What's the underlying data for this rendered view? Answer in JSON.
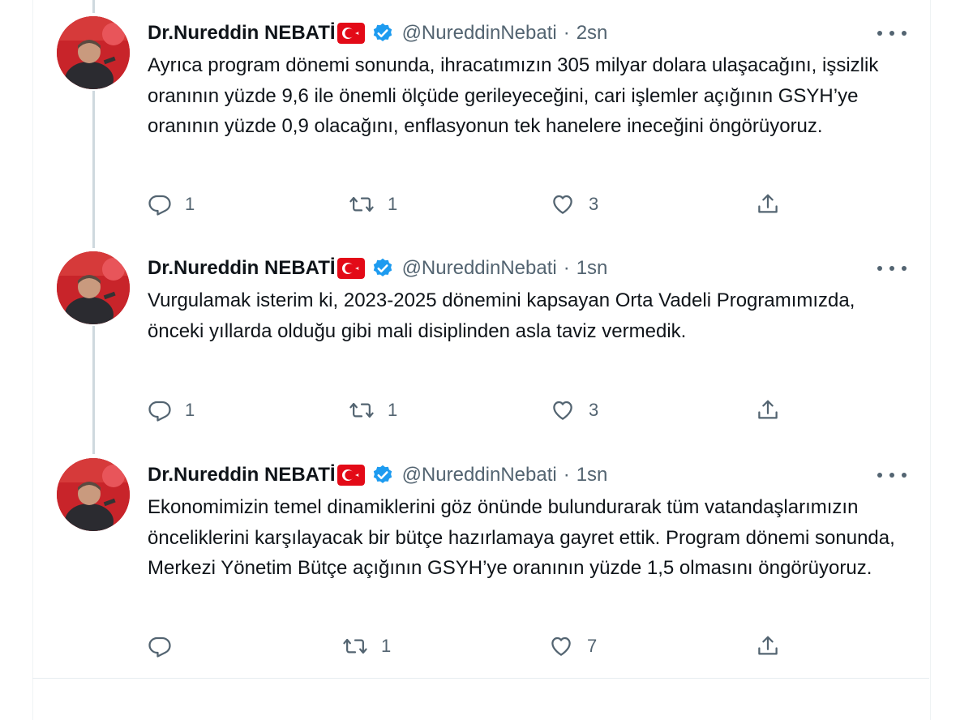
{
  "colors": {
    "text": "#0f1419",
    "secondary": "#536471",
    "verified": "#1d9bf0",
    "flag_red": "#e30a17",
    "thread_line": "#cfd9de"
  },
  "icons": {
    "reply": "reply-icon",
    "retweet": "retweet-icon",
    "like": "heart-icon",
    "share": "share-icon",
    "more": "more-icon",
    "verified": "verified-badge-icon",
    "flag": "turkey-flag-icon"
  },
  "tweets": [
    {
      "name": "Dr.Nureddin NEBATİ",
      "handle": "@NureddinNebati",
      "time": "2sn",
      "text": "Ayrıca program dönemi sonunda, ihracatımızın 305 milyar dolara ulaşacağını, işsizlik oranının yüzde 9,6 ile önemli ölçüde gerileyeceğini, cari işlemler açığının GSYH’ye oranının yüzde 0,9 olacağını, enflasyonun tek hanelere ineceğini öngörüyoruz.",
      "replies": "1",
      "retweets": "1",
      "likes": "3"
    },
    {
      "name": "Dr.Nureddin NEBATİ",
      "handle": "@NureddinNebati",
      "time": "1sn",
      "text": "Vurgulamak isterim ki, 2023-2025 dönemini kapsayan Orta Vadeli Programımızda, önceki yıllarda olduğu gibi mali disiplinden asla taviz vermedik.",
      "replies": "1",
      "retweets": "1",
      "likes": "3"
    },
    {
      "name": "Dr.Nureddin NEBATİ",
      "handle": "@NureddinNebati",
      "time": "1sn",
      "text": "Ekonomimizin temel dinamiklerini göz önünde bulundurarak tüm vatandaşlarımızın önceliklerini karşılayacak bir bütçe hazırlamaya gayret ettik. Program dönemi sonunda, Merkezi Yönetim Bütçe açığının GSYH’ye oranının yüzde 1,5 olmasını öngörüyoruz.",
      "replies": "",
      "retweets": "1",
      "likes": "7"
    }
  ]
}
